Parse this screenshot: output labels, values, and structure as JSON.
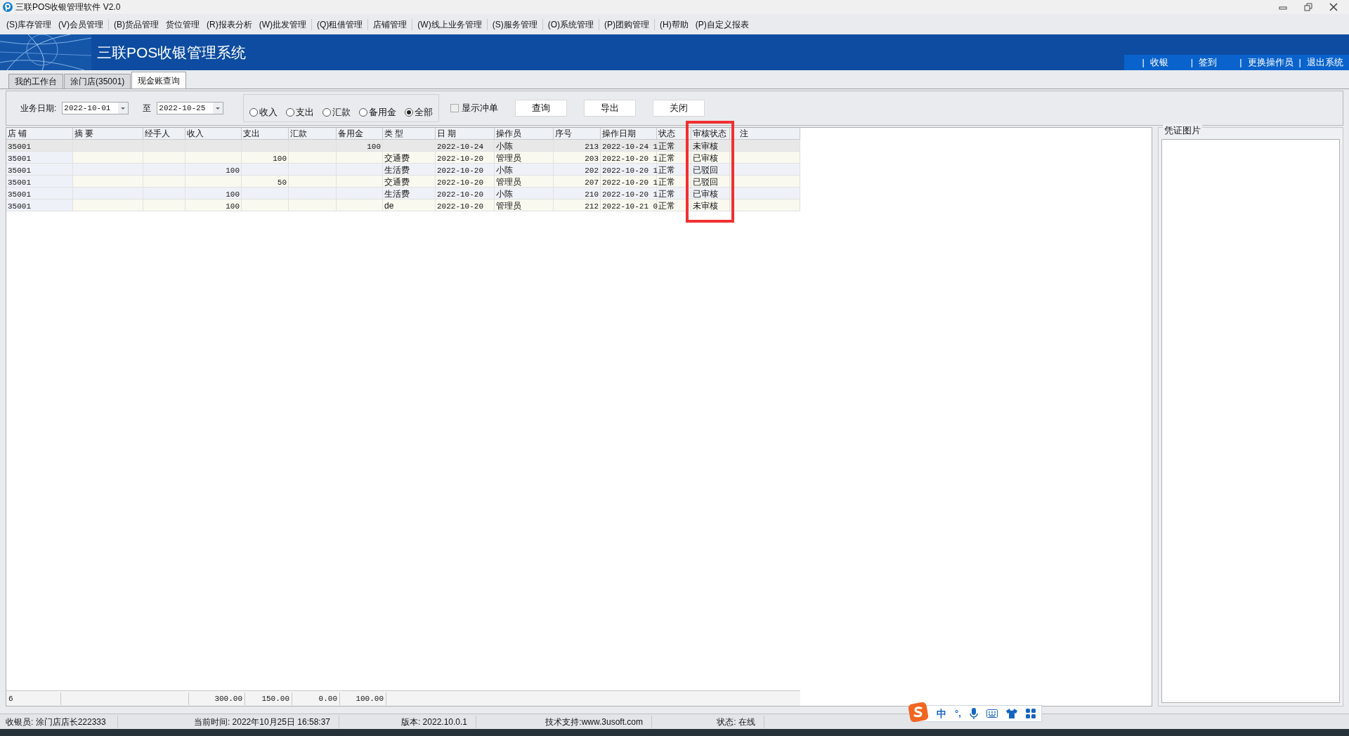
{
  "window": {
    "title": "三联POS收银管理软件 V2.0"
  },
  "menu": [
    {
      "label": "(S)库存管理"
    },
    {
      "label": "(V)会员管理"
    },
    {
      "label": "(B)货品管理"
    },
    {
      "label": "货位管理"
    },
    {
      "label": "(R)报表分析"
    },
    {
      "label": "(W)批发管理"
    },
    {
      "label": "(Q)租借管理"
    },
    {
      "label": "店铺管理"
    },
    {
      "label": "(W)线上业务管理"
    },
    {
      "label": "(S)服务管理"
    },
    {
      "label": "(O)系统管理"
    },
    {
      "label": "(P)团购管理"
    },
    {
      "label": "(H)帮助"
    },
    {
      "label": "(P)自定义报表"
    }
  ],
  "banner": {
    "title": "三联POS收银管理系统",
    "separator": "|",
    "links": [
      "收银",
      "签到",
      "更换操作员",
      "退出系统"
    ]
  },
  "tabs": [
    {
      "label": "我的工作台",
      "selected": false
    },
    {
      "label": "涂门店(35001)",
      "selected": false
    },
    {
      "label": "现金账查询",
      "selected": true
    }
  ],
  "filters": {
    "date_label": "业务日期:",
    "date_from": "2022-10-01",
    "to_label": "至",
    "date_to": "2022-10-25",
    "types": [
      {
        "label": "收入",
        "selected": false
      },
      {
        "label": "支出",
        "selected": false
      },
      {
        "label": "汇款",
        "selected": false
      },
      {
        "label": "备用金",
        "selected": false
      },
      {
        "label": "全部",
        "selected": true
      }
    ],
    "show_reversed": {
      "label": "显示冲单",
      "checked": false
    },
    "buttons": [
      "查询",
      "导出",
      "关闭"
    ]
  },
  "table": {
    "columns": [
      {
        "label": "店 铺",
        "highlighted": false
      },
      {
        "label": "摘 要",
        "highlighted": false
      },
      {
        "label": "经手人",
        "highlighted": false
      },
      {
        "label": "收入",
        "highlighted": false
      },
      {
        "label": "支出",
        "highlighted": false
      },
      {
        "label": "汇款",
        "highlighted": false
      },
      {
        "label": "备用金",
        "highlighted": false
      },
      {
        "label": "类 型",
        "highlighted": false
      },
      {
        "label": "日 期",
        "highlighted": false
      },
      {
        "label": "操作员",
        "highlighted": false
      },
      {
        "label": "序号",
        "highlighted": false
      },
      {
        "label": "操作日期",
        "highlighted": false
      },
      {
        "label": "状态",
        "highlighted": false
      },
      {
        "label": "审核状态",
        "highlighted": true
      },
      {
        "label": "注",
        "highlighted": false
      }
    ],
    "rows": [
      {
        "selected": true,
        "cells": [
          "35001",
          "",
          "",
          "",
          "",
          "",
          "100",
          "",
          "2022-10-24",
          "小陈",
          "213",
          "2022-10-24 1",
          "正常",
          "未审核",
          ""
        ]
      },
      {
        "selected": false,
        "cells": [
          "35001",
          "",
          "",
          "",
          "100",
          "",
          "",
          "交通费",
          "2022-10-20",
          "管理员",
          "203",
          "2022-10-20 1",
          "正常",
          "已审核",
          ""
        ]
      },
      {
        "selected": false,
        "cells": [
          "35001",
          "",
          "",
          "100",
          "",
          "",
          "",
          "生活费",
          "2022-10-20",
          "小陈",
          "202",
          "2022-10-20 1",
          "正常",
          "已驳回",
          ""
        ]
      },
      {
        "selected": false,
        "cells": [
          "35001",
          "",
          "",
          "",
          "50",
          "",
          "",
          "交通费",
          "2022-10-20",
          "管理员",
          "207",
          "2022-10-20 1",
          "正常",
          "已驳回",
          ""
        ]
      },
      {
        "selected": false,
        "cells": [
          "35001",
          "",
          "",
          "100",
          "",
          "",
          "",
          "生活费",
          "2022-10-20",
          "小陈",
          "210",
          "2022-10-20 1",
          "正常",
          "已审核",
          ""
        ]
      },
      {
        "selected": false,
        "cells": [
          "35001",
          "",
          "",
          "100",
          "",
          "",
          "",
          "de",
          "2022-10-20",
          "管理员",
          "212",
          "2022-10-21 0",
          "正常",
          "未审核",
          ""
        ]
      }
    ],
    "footer": [
      "6",
      "300.00",
      "150.00",
      "0.00",
      "100.00"
    ]
  },
  "side_panel": {
    "title": "凭证图片"
  },
  "status_bar": [
    "收银员: 涂门店店长222333",
    "当前时间:  2022年10月25日 16:58:37",
    "版本: 2022.10.0.1",
    "技术支持:www.3usoft.com",
    "状态: 在线"
  ],
  "ime_toolbar": {
    "mode": "中",
    "punct": "°,"
  }
}
